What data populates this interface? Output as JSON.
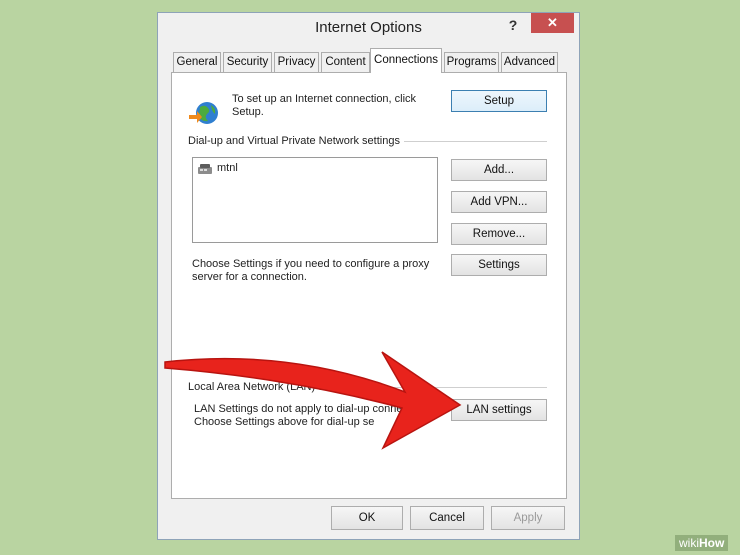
{
  "window": {
    "title": "Internet Options",
    "help": "?",
    "close": "✕"
  },
  "tabs": [
    {
      "label": "General"
    },
    {
      "label": "Security"
    },
    {
      "label": "Privacy"
    },
    {
      "label": "Content"
    },
    {
      "label": "Connections"
    },
    {
      "label": "Programs"
    },
    {
      "label": "Advanced"
    }
  ],
  "setup": {
    "text_line1": "To set up an Internet connection, click",
    "text_line2": "Setup.",
    "button": "Setup"
  },
  "dialup": {
    "group_label": "Dial-up and Virtual Private Network settings",
    "connections": [
      {
        "name": "mtnl"
      }
    ],
    "add": "Add...",
    "add_vpn": "Add VPN...",
    "remove": "Remove...",
    "settings": "Settings",
    "proxy_text_line1": "Choose Settings if you need to configure a proxy",
    "proxy_text_line2": "server for a connection."
  },
  "lan": {
    "group_label": "Local Area Network (LAN) settings",
    "text_line1": "LAN Settings do not apply to dial-up conne",
    "text_line2": "Choose Settings above for dial-up se",
    "button": "LAN settings"
  },
  "footer": {
    "ok": "OK",
    "cancel": "Cancel",
    "apply": "Apply"
  },
  "watermark": {
    "part1": "wiki",
    "part2": "How"
  },
  "colors": {
    "background": "#b9d4a1",
    "close": "#c75050",
    "arrow": "#e8231c"
  }
}
